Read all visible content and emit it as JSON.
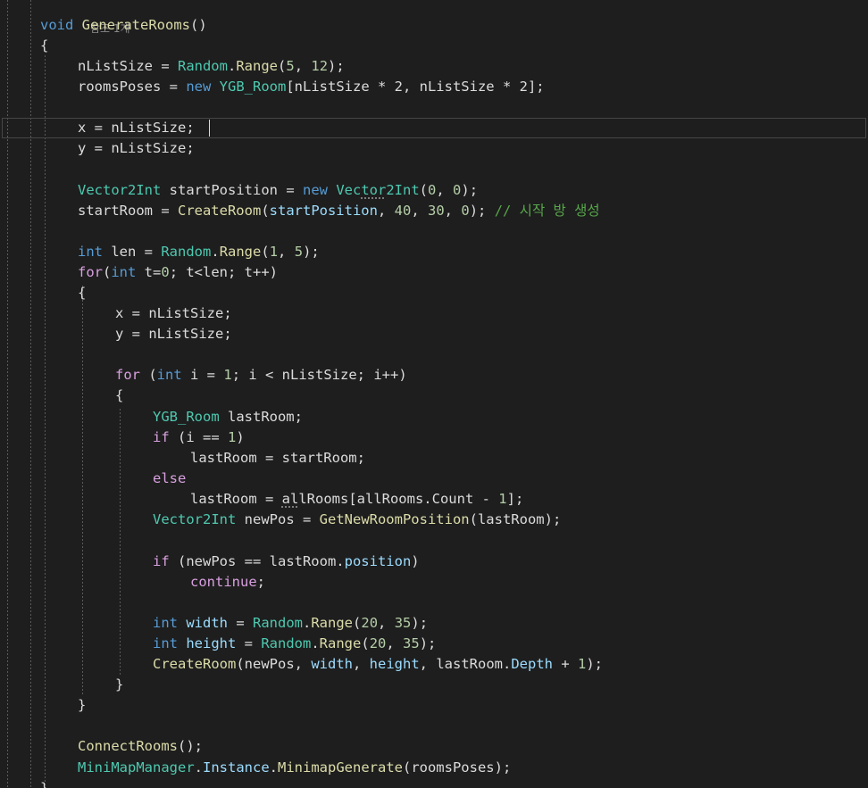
{
  "editor": {
    "reference_hint": "참조 1개",
    "method_kw": "void",
    "method_name": "GenerateRooms",
    "method_parens": "()",
    "open_brace": "{",
    "close_brace": "}",
    "l_nlist": {
      "lhs": "nListSize = ",
      "cls": "Random",
      "dot": ".",
      "fn": "Range",
      "open": "(",
      "a": "5",
      "sep": ", ",
      "b": "12",
      "close": ");"
    },
    "l_rooms": {
      "lhs": "roomsPoses = ",
      "kw": "new",
      "ty": "YGB_Room",
      "rest": "[nListSize * 2, nListSize * 2];"
    },
    "l_x1": "x = nListSize;",
    "l_y1": "y = nListSize;",
    "l_start": {
      "ty": "Vector2Int",
      "var": "startPosition",
      "eq": " = ",
      "kw": "new",
      "ty2a": "Vec",
      "ty2b": "tor",
      "ty2c": "2Int",
      "open": "(",
      "a": "0",
      "sep": ", ",
      "b": "0",
      "close": ");"
    },
    "l_room": {
      "lhs": "startRoom = ",
      "fn": "CreateRoom",
      "open": "(",
      "arg": "startPosition",
      "sep1": ", ",
      "a": "40",
      "sep2": ", ",
      "b": "30",
      "sep3": ", ",
      "c": "0",
      "close": "); ",
      "comment": "// 시작 방 생성"
    },
    "l_len": {
      "kw": "int",
      "var": "len",
      "eq": " = ",
      "cls": "Random",
      "dot": ".",
      "fn": "Range",
      "open": "(",
      "a": "1",
      "sep": ", ",
      "b": "5",
      "close": ");"
    },
    "l_for_t": {
      "kw": "for",
      "open": "(",
      "kw2": "int",
      "init": " t=",
      "zero": "0",
      "rest": "; t<len; t++)"
    },
    "l_brace2_open": "{",
    "l_x2": "x = nListSize;",
    "l_y2": "y = nListSize;",
    "l_for_i": {
      "kw": "for",
      "open": " (",
      "kw2": "int",
      "init": " i = ",
      "one": "1",
      "rest": "; i < nListSize; i++)"
    },
    "l_brace3_open": "{",
    "l_last": {
      "ty": "YGB_Room",
      "var": " lastRoom;"
    },
    "l_if1": {
      "kw": "if",
      "rest1": " (i == ",
      "one": "1",
      "rest2": ")"
    },
    "l_assign1": "lastRoom = startRoom;",
    "l_else": "else",
    "l_assign2": {
      "a": "lastRoom = ",
      "b": "al",
      "c": "lRooms[allRooms.Count - ",
      "one": "1",
      "d": "];"
    },
    "l_newpos": {
      "ty": "Vector2Int",
      "var": " newPos",
      "eq": " = ",
      "fn": "GetNewRoomPosition",
      "rest": "(lastRoom);"
    },
    "l_if2": {
      "kw": "if",
      "rest": " (newPos == lastRoom.",
      "mem": "position",
      "close": ")"
    },
    "l_continue": {
      "kw": "continue",
      "semi": ";"
    },
    "l_width": {
      "kw": "int",
      "var": " width",
      "eq": " = ",
      "cls": "Random",
      "dot": ".",
      "fn": "Range",
      "open": "(",
      "a": "20",
      "sep": ", ",
      "b": "35",
      "close": ");"
    },
    "l_height": {
      "kw": "int",
      "var": " height",
      "eq": " = ",
      "cls": "Random",
      "dot": ".",
      "fn": "Range",
      "open": "(",
      "a": "20",
      "sep": ", ",
      "b": "35",
      "close": ");"
    },
    "l_create": {
      "fn": "CreateRoom",
      "open": "(newPos, ",
      "w": "width",
      "sep": ", ",
      "h": "height",
      "mid": ", lastRoom.",
      "mem": "Depth",
      "plus": " + ",
      "one": "1",
      "close": ");"
    },
    "l_brace3_close": "}",
    "l_brace2_close": "}",
    "l_connect": {
      "fn": "ConnectRooms",
      "close": "();"
    },
    "l_minimap": {
      "ty": "MiniMapManager",
      "dot1": ".",
      "mem": "Instance",
      "dot2": ".",
      "fn": "MinimapGenerate",
      "rest": "(roomsPoses);"
    }
  }
}
